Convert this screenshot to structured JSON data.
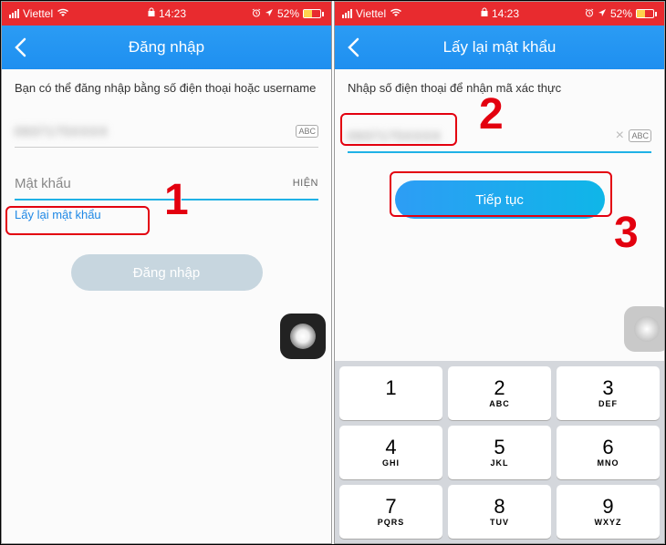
{
  "status": {
    "carrier": "Viettel",
    "time": "14:23",
    "battery_pct": "52%"
  },
  "annotations": {
    "n1": "1",
    "n2": "2",
    "n3": "3"
  },
  "left": {
    "title": "Đăng nhập",
    "instruction": "Bạn có thể đăng nhập bằng số điện thoại hoặc username",
    "phone_masked": "0937175XXXX",
    "abc": "ABC",
    "password_placeholder": "Mật khẩu",
    "show_label": "HIỆN",
    "forgot": "Lấy lại mật khẩu",
    "login_btn": "Đăng nhập"
  },
  "right": {
    "title": "Lấy lại mật khẩu",
    "instruction": "Nhập số điện thoại để nhận mã xác thực",
    "phone_masked": "0937175XXXX",
    "abc": "ABC",
    "continue_btn": "Tiếp tục",
    "keys": [
      {
        "n": "1",
        "l": ""
      },
      {
        "n": "2",
        "l": "ABC"
      },
      {
        "n": "3",
        "l": "DEF"
      },
      {
        "n": "4",
        "l": "GHI"
      },
      {
        "n": "5",
        "l": "JKL"
      },
      {
        "n": "6",
        "l": "MNO"
      },
      {
        "n": "7",
        "l": "PQRS"
      },
      {
        "n": "8",
        "l": "TUV"
      },
      {
        "n": "9",
        "l": "WXYZ"
      }
    ]
  }
}
